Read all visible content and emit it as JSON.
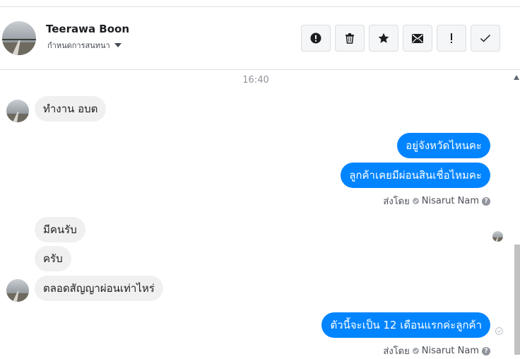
{
  "header": {
    "name": "Teerawa Boon",
    "subtitle": "กำหนดการสนทนา",
    "tools": [
      {
        "icon": "alert-circle-icon"
      },
      {
        "icon": "trash-icon"
      },
      {
        "icon": "star-icon"
      },
      {
        "icon": "envelope-icon"
      },
      {
        "icon": "exclamation-icon"
      },
      {
        "icon": "checkmark-icon"
      }
    ]
  },
  "conversation": {
    "timestamp": "16:40",
    "messages": [
      {
        "direction": "in",
        "text": "ทำงาน อบต"
      },
      {
        "direction": "out",
        "text": "อยู่จังหวัดไหนคะ"
      },
      {
        "direction": "out",
        "text": "ลูกค้าเคยมีผ่อนสินเชื่อไหมคะ"
      },
      {
        "direction": "in",
        "text": "มีคนรับ"
      },
      {
        "direction": "in",
        "text": "ครับ"
      },
      {
        "direction": "in",
        "text": "ตลอดสัญญาผ่อนเท่าไหร่"
      },
      {
        "direction": "out",
        "text": "ตัวนี้จะเป็น 12 เดือนแรกค่ะลูกค้า"
      }
    ],
    "sent_by": [
      {
        "prefix": "ส่งโดย",
        "name": "Nisarut Nam",
        "help": "?"
      },
      {
        "prefix": "ส่งโดย",
        "name": "Nisarut Nam",
        "help": "?"
      }
    ]
  },
  "colors": {
    "outgoing_bubble": "#0084ff",
    "incoming_bubble": "#f1f0f0",
    "divider": "#dddfe2"
  }
}
